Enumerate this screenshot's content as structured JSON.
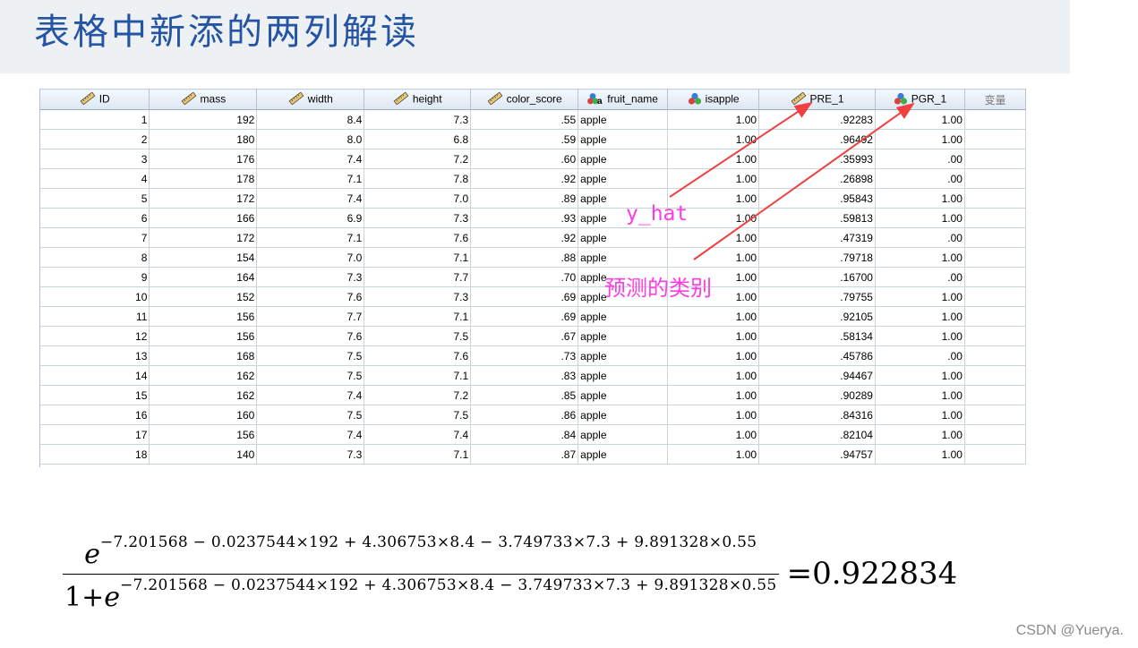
{
  "title": "表格中新添的两列解读",
  "columns": [
    {
      "label": "ID",
      "icon": "ruler-icon",
      "align": "right"
    },
    {
      "label": "mass",
      "icon": "ruler-icon",
      "align": "right"
    },
    {
      "label": "width",
      "icon": "ruler-icon",
      "align": "right"
    },
    {
      "label": "height",
      "icon": "ruler-icon",
      "align": "right"
    },
    {
      "label": "color_score",
      "icon": "ruler-icon",
      "align": "right"
    },
    {
      "label": "fruit_name",
      "icon": "nominal-string-icon",
      "align": "left"
    },
    {
      "label": "isapple",
      "icon": "nominal-icon",
      "align": "right"
    },
    {
      "label": "PRE_1",
      "icon": "ruler-icon",
      "align": "right"
    },
    {
      "label": "PGR_1",
      "icon": "nominal-icon",
      "align": "right"
    },
    {
      "label": "变量",
      "icon": "",
      "align": "right"
    }
  ],
  "rows": [
    [
      "1",
      "192",
      "8.4",
      "7.3",
      ".55",
      "apple",
      "1.00",
      ".92283",
      "1.00",
      ""
    ],
    [
      "2",
      "180",
      "8.0",
      "6.8",
      ".59",
      "apple",
      "1.00",
      ".96492",
      "1.00",
      ""
    ],
    [
      "3",
      "176",
      "7.4",
      "7.2",
      ".60",
      "apple",
      "1.00",
      ".35993",
      ".00",
      ""
    ],
    [
      "4",
      "178",
      "7.1",
      "7.8",
      ".92",
      "apple",
      "1.00",
      ".26898",
      ".00",
      ""
    ],
    [
      "5",
      "172",
      "7.4",
      "7.0",
      ".89",
      "apple",
      "1.00",
      ".95843",
      "1.00",
      ""
    ],
    [
      "6",
      "166",
      "6.9",
      "7.3",
      ".93",
      "apple",
      "1.00",
      ".59813",
      "1.00",
      ""
    ],
    [
      "7",
      "172",
      "7.1",
      "7.6",
      ".92",
      "apple",
      "1.00",
      ".47319",
      ".00",
      ""
    ],
    [
      "8",
      "154",
      "7.0",
      "7.1",
      ".88",
      "apple",
      "1.00",
      ".79718",
      "1.00",
      ""
    ],
    [
      "9",
      "164",
      "7.3",
      "7.7",
      ".70",
      "apple",
      "1.00",
      ".16700",
      ".00",
      ""
    ],
    [
      "10",
      "152",
      "7.6",
      "7.3",
      ".69",
      "apple",
      "1.00",
      ".79755",
      "1.00",
      ""
    ],
    [
      "11",
      "156",
      "7.7",
      "7.1",
      ".69",
      "apple",
      "1.00",
      ".92105",
      "1.00",
      ""
    ],
    [
      "12",
      "156",
      "7.6",
      "7.5",
      ".67",
      "apple",
      "1.00",
      ".58134",
      "1.00",
      ""
    ],
    [
      "13",
      "168",
      "7.5",
      "7.6",
      ".73",
      "apple",
      "1.00",
      ".45786",
      ".00",
      ""
    ],
    [
      "14",
      "162",
      "7.5",
      "7.1",
      ".83",
      "apple",
      "1.00",
      ".94467",
      "1.00",
      ""
    ],
    [
      "15",
      "162",
      "7.4",
      "7.2",
      ".85",
      "apple",
      "1.00",
      ".90289",
      "1.00",
      ""
    ],
    [
      "16",
      "160",
      "7.5",
      "7.5",
      ".86",
      "apple",
      "1.00",
      ".84316",
      "1.00",
      ""
    ],
    [
      "17",
      "156",
      "7.4",
      "7.4",
      ".84",
      "apple",
      "1.00",
      ".82104",
      "1.00",
      ""
    ],
    [
      "18",
      "140",
      "7.3",
      "7.1",
      ".87",
      "apple",
      "1.00",
      ".94757",
      "1.00",
      ""
    ]
  ],
  "annotations": {
    "y_hat": "y_hat",
    "predicted_class": "预测的类别",
    "arrow_color": "#f04040",
    "text_color": "#ff3be3"
  },
  "formula": {
    "numerator_base": "e",
    "exponent": "−7.201568 − 0.0237544×192 + 4.306753×8.4 − 3.749733×7.3 + 9.891328×0.55",
    "denominator_prefix": "1+",
    "denominator_base": "e",
    "result": "=0.922834"
  },
  "watermark": "CSDN @Yuerya."
}
